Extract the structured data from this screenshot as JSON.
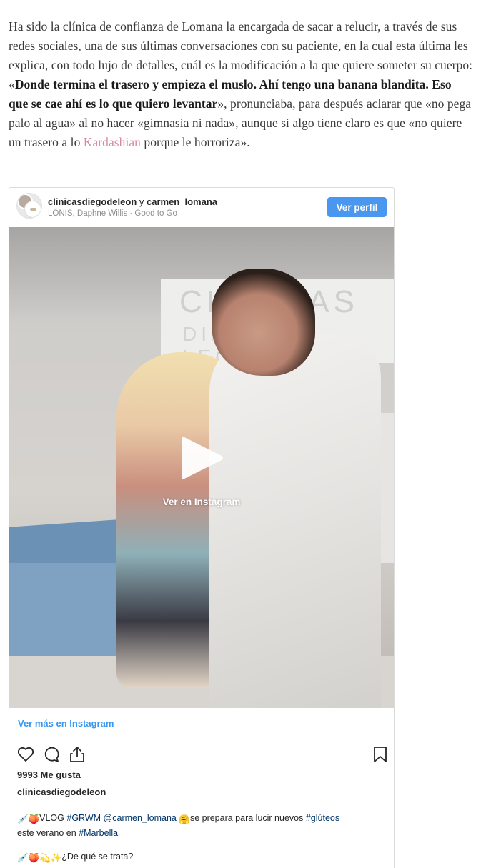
{
  "article": {
    "p1_before": "Ha sido la clínica de confianza de Lomana la encargada de sacar a relucir, a través de sus redes sociales, una de sus últimas conversaciones con su paciente, en la cual esta última les explica, con todo lujo de detalles, cuál es la modificación a la que quiere someter su cuerpo: «",
    "p1_bold": "Donde termina el trasero y empieza el muslo. Ahí tengo una banana blandita. Eso que se cae ahí es lo que quiero levantar",
    "p1_after": "», pronunciaba, para después aclarar que «no pega palo al agua» al no hacer «gimnasia ni nada», aunque si algo tiene claro es que «no quiere un trasero a lo ",
    "p1_link": "Kardashian",
    "p1_end": " porque le horroriza»."
  },
  "embed": {
    "account_1": "clinicasdiegodeleon",
    "conjunction": " y ",
    "account_2": "carmen_lomana",
    "music": "LÖNIS, Daphne Willis · Good to Go",
    "profile_button": "Ver perfil",
    "sign_line_1": "CLINICAS",
    "sign_line_2": "DIEGO DE LEÓN",
    "watch_label": "Ver en Instagram",
    "more_link": "Ver más en Instagram",
    "likes": "9993 Me gusta",
    "owner": "clinicasdiegodeleon",
    "caption_emoji_1": "💉🍑",
    "caption_tag_1": "VLOG",
    "caption_tag_2": "#GRWM",
    "caption_mention": "@carmen_lomana",
    "caption_emoji_2": "🤗",
    "caption_text_1": "se prepara para lucir nuevos",
    "caption_tag_3": "#glúteos",
    "caption_text_2": "este verano en",
    "caption_tag_4": "#Marbella",
    "caption2_emoji": "💉🍑💫✨",
    "caption2_text": "¿De qué se trata?"
  },
  "icons": [
    "heart-icon",
    "comment-icon",
    "share-icon",
    "bookmark-icon",
    "play-icon"
  ],
  "colors": {
    "button_blue": "#4a97f0",
    "link_blue": "#3897f0",
    "article_link_pink": "#d98aa0"
  }
}
